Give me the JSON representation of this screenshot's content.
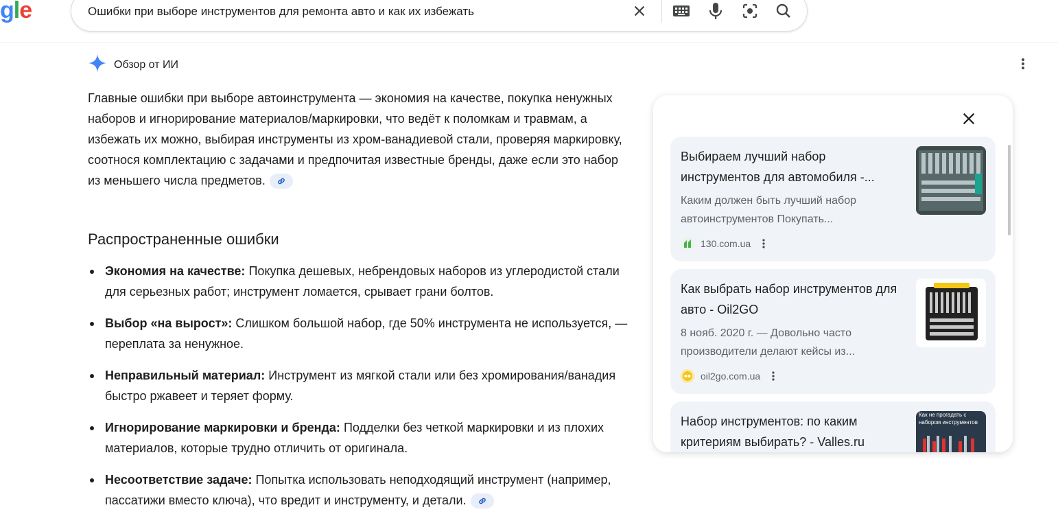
{
  "logo": {
    "text_g": "g",
    "text_l": "l",
    "text_e": "e"
  },
  "search": {
    "query": "Ошибки при выборе инструментов для ремонта авто и как их избежать",
    "icons": [
      "close-icon",
      "keyboard-icon",
      "mic-icon",
      "lens-icon",
      "search-icon"
    ]
  },
  "ai_overview": {
    "title": "Обзор от ИИ",
    "intro": "Главные ошибки при выборе автоинструмента — экономия на качестве, покупка ненужных наборов и игнорирование материалов/маркировки, что ведёт к поломкам и травмам, а избежать их можно, выбирая инструменты из хром-ванадиевой стали, проверяя маркировку, соотнося комплектацию с задачами и предпочитая известные бренды, даже если это набор из меньшего числа предметов.",
    "section_title": "Распространенные ошибки",
    "bullets": [
      {
        "bold": "Экономия на качестве:",
        "text": " Покупка дешевых, небрендовых наборов из углеродистой стали для серьезных работ; инструмент ломается, срывает грани болтов."
      },
      {
        "bold": "Выбор «на вырост»:",
        "text": " Слишком большой набор, где 50% инструмента не используется, — переплата за ненужное."
      },
      {
        "bold": "Неправильный материал:",
        "text": " Инструмент из мягкой стали или без хромирования/ванадия быстро ржавеет и теряет форму."
      },
      {
        "bold": "Игнорирование маркировки и бренда:",
        "text": " Подделки без четкой маркировки и из плохих материалов, которые трудно отличить от оригинала."
      },
      {
        "bold": "Несоответствие задаче:",
        "text": " Попытка использовать неподходящий инструмент (например, пассатижи вместо ключа), что вредит и инструменту, и детали."
      }
    ]
  },
  "sources": [
    {
      "title": "Выбираем лучший набор инструментов для автомобиля -...",
      "snippet": "Каким должен быть лучший набор автоинструментов Покупать...",
      "domain": "130.com.ua",
      "favicon_color": "#4caf50"
    },
    {
      "title": "Как выбрать набор инструментов для авто - Oil2GO",
      "snippet": "8 нояб. 2020 г. — Довольно часто производители делают кейсы из...",
      "domain": "oil2go.com.ua",
      "favicon_color": "#f5c518"
    },
    {
      "title": "Набор инструментов: по каким критериям выбирать? - Valles.ru",
      "thumb_text": "Как не прогадать с набором инструментов"
    }
  ],
  "colors": {
    "accent": "#4285f4",
    "chip": "#e8eef9",
    "card": "#f0f4f9",
    "muted": "#5f6368"
  }
}
